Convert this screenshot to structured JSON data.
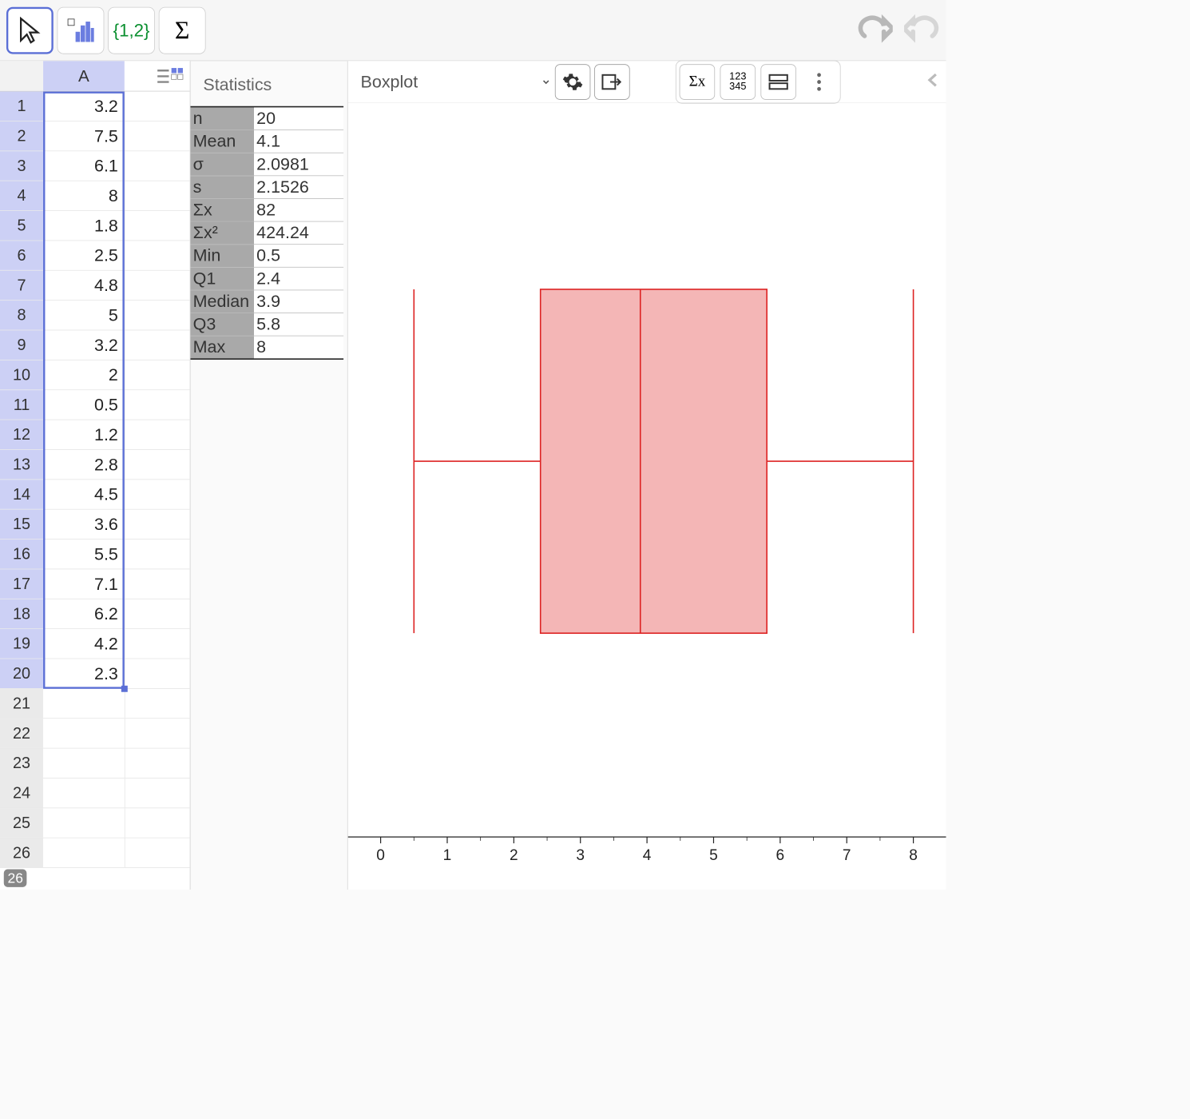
{
  "toolbar": {
    "list_label": "{1,2}",
    "sigma_label": "Σ"
  },
  "spreadsheet": {
    "column_header": "A",
    "visible_rows": 26,
    "selection_end_row": 20,
    "footer_row": "26",
    "values": [
      "3.2",
      "7.5",
      "6.1",
      "8",
      "1.8",
      "2.5",
      "4.8",
      "5",
      "3.2",
      "2",
      "0.5",
      "1.2",
      "2.8",
      "4.5",
      "3.6",
      "5.5",
      "7.1",
      "6.2",
      "4.2",
      "2.3"
    ]
  },
  "stats": {
    "title": "Statistics",
    "rows": [
      {
        "k": "n",
        "v": "20"
      },
      {
        "k": "Mean",
        "v": "4.1"
      },
      {
        "k": "σ",
        "v": "2.0981"
      },
      {
        "k": "s",
        "v": "2.1526"
      },
      {
        "k": "Σx",
        "v": "82"
      },
      {
        "k": "Σx²",
        "v": "424.24"
      },
      {
        "k": "Min",
        "v": "0.5"
      },
      {
        "k": "Q1",
        "v": "2.4"
      },
      {
        "k": "Median",
        "v": "3.9"
      },
      {
        "k": "Q3",
        "v": "5.8"
      },
      {
        "k": "Max",
        "v": "8"
      }
    ]
  },
  "plot": {
    "type_label": "Boxplot",
    "xaxis_ticks": [
      0,
      1,
      2,
      3,
      4,
      5,
      6,
      7,
      8
    ]
  },
  "chart_data": {
    "type": "boxplot",
    "title": "",
    "xlabel": "",
    "ylabel": "",
    "xlim": [
      -0.3,
      8.3
    ],
    "min": 0.5,
    "q1": 2.4,
    "median": 3.9,
    "q3": 5.8,
    "max": 8,
    "n": 20,
    "raw_values": [
      3.2,
      7.5,
      6.1,
      8,
      1.8,
      2.5,
      4.8,
      5,
      3.2,
      2,
      0.5,
      1.2,
      2.8,
      4.5,
      3.6,
      5.5,
      7.1,
      6.2,
      4.2,
      2.3
    ],
    "colors": {
      "box_fill": "#f4b6b6",
      "stroke": "#d22"
    }
  }
}
